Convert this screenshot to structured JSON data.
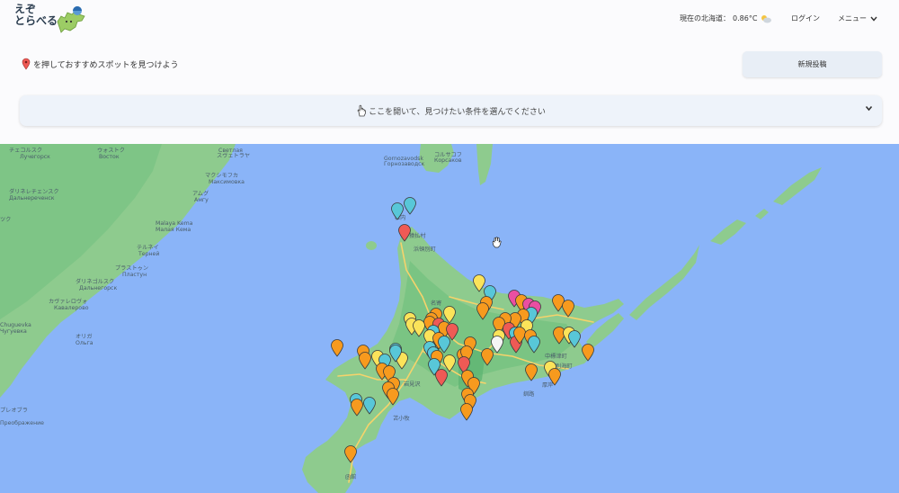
{
  "header": {
    "logo_line1": "えぞ",
    "logo_line2": "とらべる",
    "weather_label": "現在の北海道：",
    "weather_temp": "0.86°C",
    "weather_icon": "partly-cloudy-icon",
    "login_label": "ログイン",
    "menu_label": "メニュー"
  },
  "hint": {
    "icon": "map-pin-icon",
    "text": "を押しておすすめスポットを見つけよう"
  },
  "new_post_label": "新規投稿",
  "conditions": {
    "icon": "pointer-hand-icon",
    "label": "ここを開いて、見つけたい条件を選んでください"
  },
  "map": {
    "colors": {
      "sea": "#8ab4f8",
      "land": "#8ecb8e",
      "forest": "#6fbe7f",
      "road": "#f6d36b",
      "pin_orange": "#f79a1e",
      "pin_red": "#ef5a55",
      "pin_cyan": "#58c7d8",
      "pin_yellow": "#fbe35a",
      "pin_pink": "#ea4fa2",
      "pin_white": "#f5f5f5"
    },
    "labels": [
      {
        "text": "Корсаков",
        "name": "label-korsakov"
      },
      {
        "text": "コルサコフ",
        "name": "label-korsakov-jp"
      },
      {
        "text": "Gornozavodsk",
        "name": "label-gornozavodsk"
      },
      {
        "text": "Горнозаводск",
        "name": "label-gornozavodsk-ru"
      },
      {
        "text": "Светлая",
        "name": "label-svetlaya"
      },
      {
        "text": "スヴェトラヤ",
        "name": "label-svetlaya-jp"
      },
      {
        "text": "ウォストク",
        "name": "label-vostok-jp"
      },
      {
        "text": "Восток",
        "name": "label-vostok"
      },
      {
        "text": "チェコルスク",
        "name": "label-luchegorsk-jp"
      },
      {
        "text": "Лучегорск",
        "name": "label-luchegorsk"
      },
      {
        "text": "マクシモフカ",
        "name": "label-maksimovka-jp"
      },
      {
        "text": "Максимовка",
        "name": "label-maksimovka"
      },
      {
        "text": "アムグ",
        "name": "label-amgu-jp"
      },
      {
        "text": "Амгу",
        "name": "label-amgu"
      },
      {
        "text": "Malaya Kema",
        "name": "label-malaya-kema"
      },
      {
        "text": "Малая Кема",
        "name": "label-malaya-kema-ru"
      },
      {
        "text": "テルネイ",
        "name": "label-terney-jp"
      },
      {
        "text": "Терней",
        "name": "label-terney"
      },
      {
        "text": "プラストゥン",
        "name": "label-plastun-jp"
      },
      {
        "text": "Пластун",
        "name": "label-plastun"
      },
      {
        "text": "ダリネゴルスク",
        "name": "label-dalnegorsk-jp"
      },
      {
        "text": "Дальнегорск",
        "name": "label-dalnegorsk"
      },
      {
        "text": "カヴァレロヴォ",
        "name": "label-kavalerovo-jp"
      },
      {
        "text": "Кавалерово",
        "name": "label-kavalerovo"
      },
      {
        "text": "Chuguevka",
        "name": "label-chuguevka"
      },
      {
        "text": "Чугуевка",
        "name": "label-chuguevka-ru"
      },
      {
        "text": "オリガ",
        "name": "label-olga-jp"
      },
      {
        "text": "Ольга",
        "name": "label-olga"
      },
      {
        "text": "ダリネレチェンスク",
        "name": "label-dalnerechensk-jp"
      },
      {
        "text": "Дальнереченск",
        "name": "label-dalnerechensk"
      },
      {
        "text": "プレオブラ",
        "name": "label-preobrazhenie-jp"
      },
      {
        "text": "Преображение",
        "name": "label-preobrazhenie"
      },
      {
        "text": "ツク",
        "name": "label-partial-west"
      },
      {
        "text": "稚内",
        "name": "label-wakkanai"
      },
      {
        "text": "猿払村",
        "name": "label-sarufutsu"
      },
      {
        "text": "浜頓別町",
        "name": "label-hamatonbetsu"
      },
      {
        "text": "名寄",
        "name": "label-nayoro"
      },
      {
        "text": "士別",
        "name": "label-shibetsu"
      },
      {
        "text": "岩見沢",
        "name": "label-iwamizawa"
      },
      {
        "text": "苫小牧",
        "name": "label-tomakomai"
      },
      {
        "text": "釧路",
        "name": "label-kushiro"
      },
      {
        "text": "厚岸",
        "name": "label-akkeshi"
      },
      {
        "text": "中標津町",
        "name": "label-nakashibetsu"
      },
      {
        "text": "別海町",
        "name": "label-betsukai"
      },
      {
        "text": "函館",
        "name": "label-hakodate"
      }
    ]
  }
}
